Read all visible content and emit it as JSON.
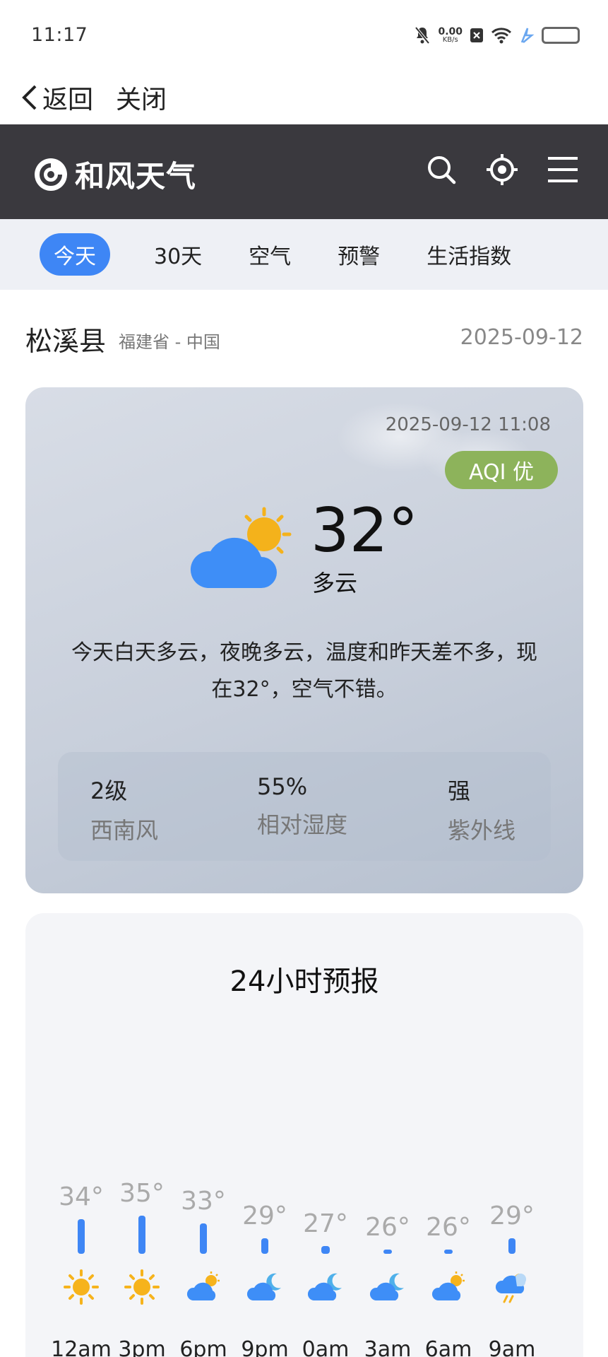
{
  "status_bar": {
    "time": "11:17",
    "net_speed": "0.00",
    "net_unit": "KB/s"
  },
  "nav": {
    "back_label": "返回",
    "close_label": "关闭"
  },
  "brand": {
    "name": "和风天气"
  },
  "tabs": [
    {
      "label": "今天",
      "active": true
    },
    {
      "label": "30天"
    },
    {
      "label": "空气"
    },
    {
      "label": "预警"
    },
    {
      "label": "生活指数"
    }
  ],
  "location": {
    "city": "松溪县",
    "region": "福建省 - 中国",
    "date": "2025-09-12"
  },
  "current": {
    "observed": "2025-09-12 11:08",
    "aqi": "AQI 优",
    "temp": "32°",
    "condition": "多云",
    "summary": "今天白天多云，夜晚多云，温度和昨天差不多，现在32°，空气不错。",
    "stats": [
      {
        "value": "2级",
        "label": "西南风"
      },
      {
        "value": "55%",
        "label": "相对湿度"
      },
      {
        "value": "强",
        "label": "紫外线"
      }
    ],
    "colors": {
      "aqi_badge": "#8db35b"
    }
  },
  "forecast_24h": {
    "title": "24小时预报",
    "hours": [
      {
        "label": "12am",
        "temp": "34°",
        "value": 34,
        "icon": "sun-icon"
      },
      {
        "label": "3pm",
        "temp": "35°",
        "value": 35,
        "icon": "sun-icon"
      },
      {
        "label": "6pm",
        "temp": "33°",
        "value": 33,
        "icon": "partly-cloudy-day-icon"
      },
      {
        "label": "9pm",
        "temp": "29°",
        "value": 29,
        "icon": "partly-cloudy-night-icon"
      },
      {
        "label": "0am",
        "temp": "27°",
        "value": 27,
        "icon": "partly-cloudy-night-icon"
      },
      {
        "label": "3am",
        "temp": "26°",
        "value": 26,
        "icon": "partly-cloudy-night-icon"
      },
      {
        "label": "6am",
        "temp": "26°",
        "value": 26,
        "icon": "partly-cloudy-day-icon"
      },
      {
        "label": "9am",
        "temp": "29°",
        "value": 29,
        "icon": "thunder-rain-icon"
      }
    ],
    "colors": {
      "bar": "#3e86f5"
    }
  }
}
